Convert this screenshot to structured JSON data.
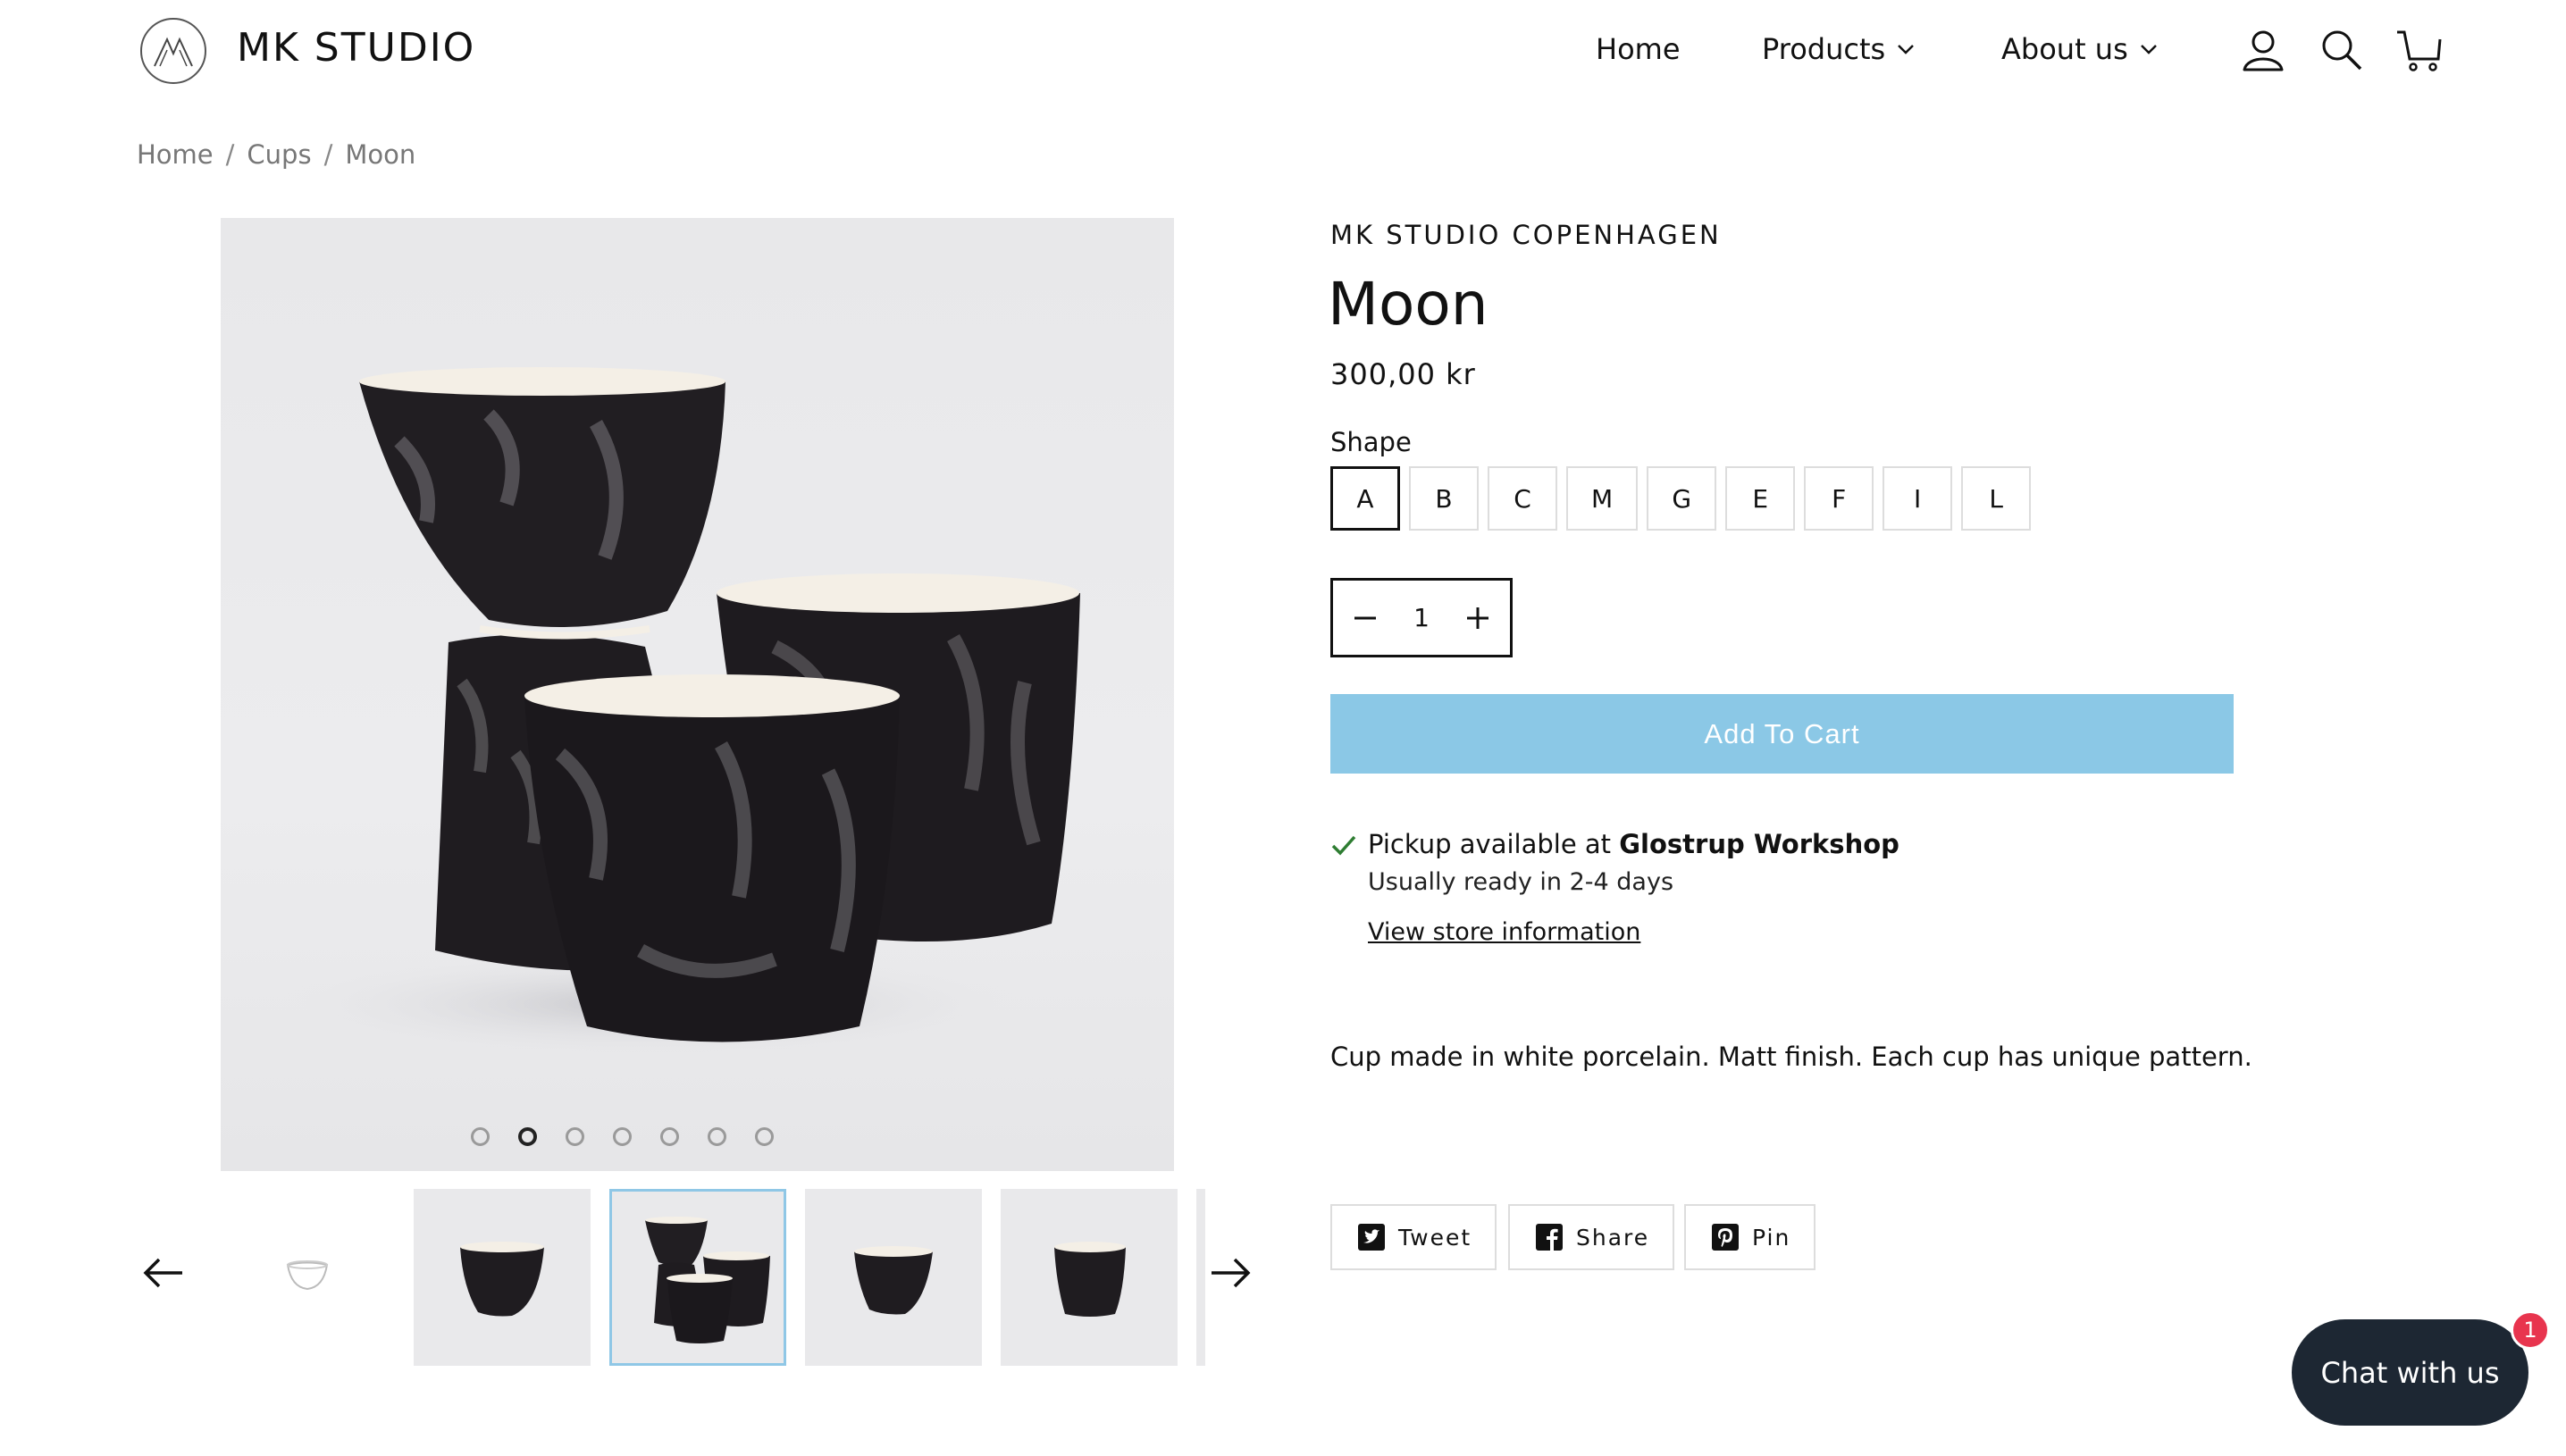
{
  "header": {
    "brand": "MK STUDIO",
    "nav": [
      {
        "label": "Home"
      },
      {
        "label": "Products"
      },
      {
        "label": "About us"
      }
    ],
    "icons": [
      "account-icon",
      "search-icon",
      "cart-icon"
    ]
  },
  "breadcrumb": [
    "Home",
    "Cups",
    "Moon"
  ],
  "gallery": {
    "dot_count": 7,
    "active_dot": 2,
    "thumbnails": 6,
    "selected_thumbnail": 3
  },
  "product": {
    "vendor": "MK STUDIO COPENHAGEN",
    "title": "Moon",
    "price": "300,00 kr",
    "shape_label": "Shape",
    "shapes": [
      "A",
      "B",
      "C",
      "M",
      "G",
      "E",
      "F",
      "I",
      "L"
    ],
    "selected_shape": "A",
    "quantity": "1",
    "add_to_cart": "Add To Cart",
    "pickup_prefix": "Pickup available at ",
    "pickup_location": "Glostrup Workshop",
    "pickup_ready": "Usually ready in 2-4 days",
    "store_link": "View store information",
    "description": "Cup made in white porcelain. Matt finish. Each cup has unique pattern."
  },
  "share": {
    "tweet": "Tweet",
    "share": "Share",
    "pin": "Pin"
  },
  "chat": {
    "label": "Chat with us",
    "badge": "1"
  },
  "colors": {
    "accent": "#8bc8e6",
    "chat_bg": "#1d2733",
    "badge": "#e8344e",
    "check": "#2e7d32"
  }
}
